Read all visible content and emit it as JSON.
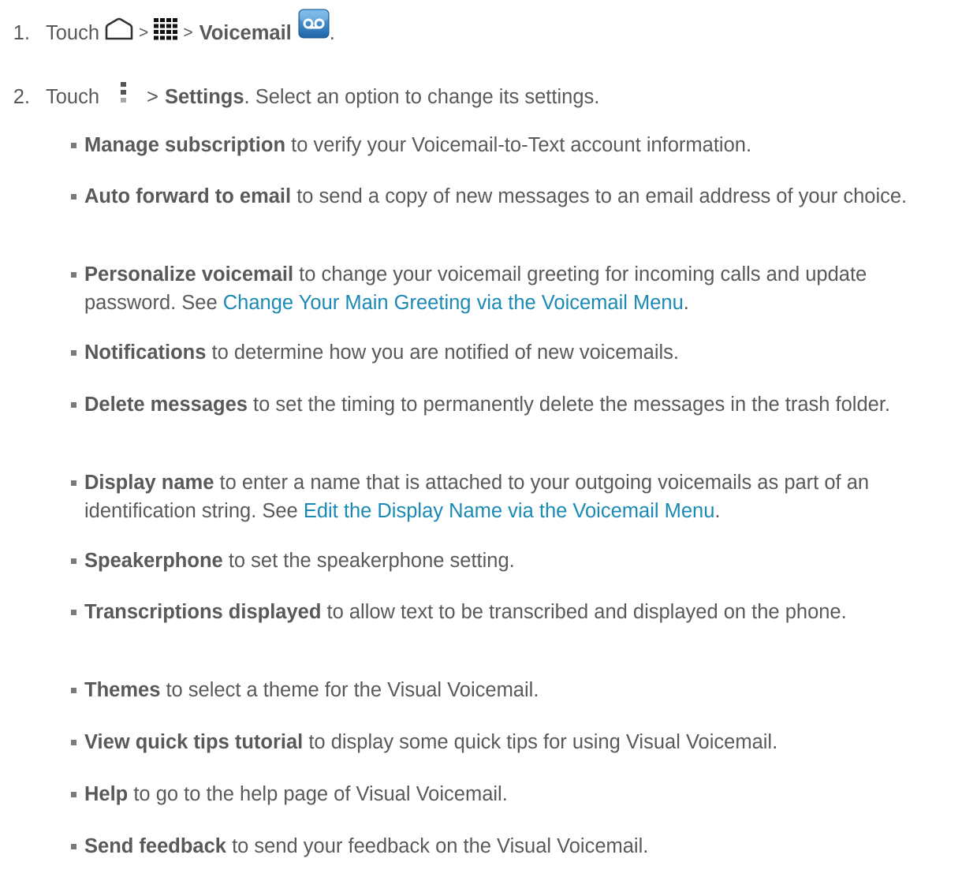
{
  "steps": [
    {
      "number": "1.",
      "touch": "Touch",
      "sep1": ">",
      "sep2": ">",
      "app": "Voicemail",
      "end": ".",
      "icons": [
        "home-icon",
        "apps-grid-icon",
        "voicemail-app-icon"
      ]
    },
    {
      "number": "2.",
      "touch": "Touch",
      "sep": ">",
      "menu_item": "Settings",
      "rest": ". Select an option to change its settings.",
      "icons": [
        "menu-dots-icon"
      ]
    }
  ],
  "options": [
    {
      "name": "Manage subscription",
      "desc": " to verify your Voicemail-to-Text account information."
    },
    {
      "name": "Auto forward to email",
      "desc": " to send a copy of new messages to an email address of your choice."
    },
    {
      "name": "Personalize voicemail",
      "desc": " to change your voicemail greeting for incoming calls and update password. See ",
      "link": "Change Your Main Greeting via the Voicemail Menu",
      "end": "."
    },
    {
      "name": "Notifications",
      "desc": " to determine how you are notified of new voicemails."
    },
    {
      "name": "Delete messages",
      "desc": " to set the timing to permanently delete the messages in the trash folder."
    },
    {
      "name": "Display name",
      "desc": " to enter a name that is attached to your outgoing voicemails as part of an identification string. See ",
      "link": "Edit the Display Name via the Voicemail Menu",
      "end": "."
    },
    {
      "name": "Speakerphone",
      "desc": " to set the speakerphone setting."
    },
    {
      "name": "Transcriptions displayed",
      "desc": " to allow text to be transcribed and displayed on the phone."
    },
    {
      "name": "Themes",
      "desc": " to select a theme for the Visual Voicemail."
    },
    {
      "name": "View quick tips tutorial",
      "desc": " to display some quick tips for using Visual Voicemail."
    },
    {
      "name": "Help",
      "desc": " to go to the help page of Visual Voicemail."
    },
    {
      "name": "Send feedback",
      "desc": " to send your feedback on the Visual Voicemail."
    }
  ],
  "colors": {
    "text": "#595959",
    "link": "#1a8ab5",
    "icon_blue": "#2f7fc1"
  }
}
